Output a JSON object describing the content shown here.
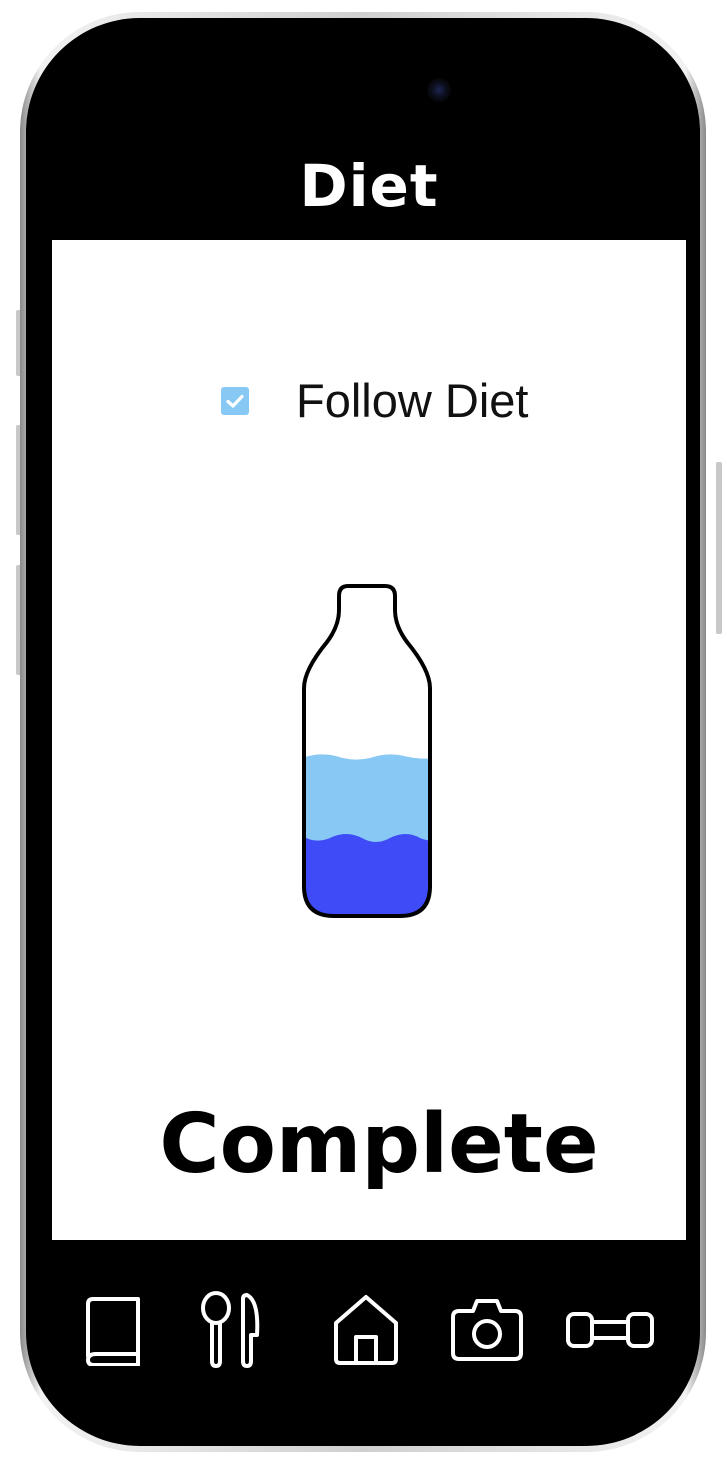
{
  "app": {
    "title": "Diet"
  },
  "diet_checkbox": {
    "label": "Follow Diet",
    "checked": true,
    "color": "#87c8f4"
  },
  "water_bottle": {
    "fill_fraction": 0.45,
    "light_water_color": "#87c8f4",
    "dark_water_color": "#3e4bf7"
  },
  "status": {
    "text": "Complete"
  },
  "nav": {
    "items": [
      {
        "icon": "book-icon"
      },
      {
        "icon": "spoon-knife-icon"
      },
      {
        "icon": "home-icon"
      },
      {
        "icon": "camera-icon"
      },
      {
        "icon": "dumbbell-icon"
      }
    ]
  }
}
